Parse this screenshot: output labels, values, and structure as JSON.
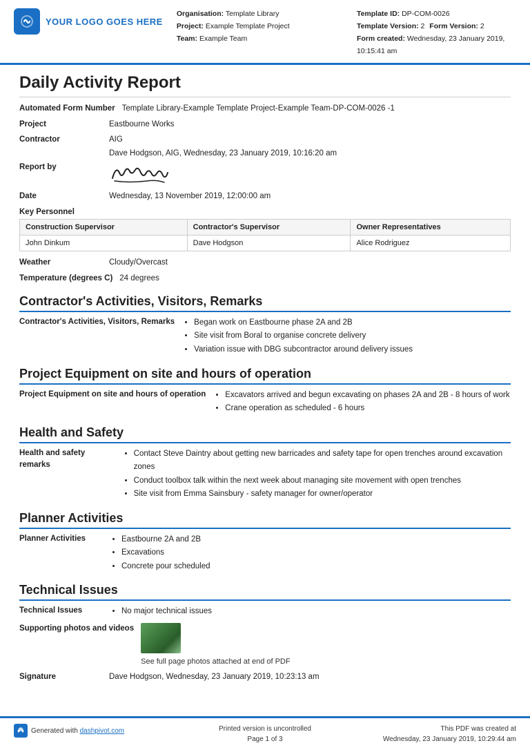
{
  "header": {
    "logo_text": "YOUR LOGO GOES HERE",
    "organisation_label": "Organisation:",
    "organisation_value": "Template Library",
    "project_label": "Project:",
    "project_value": "Example Template Project",
    "team_label": "Team:",
    "team_value": "Example Team",
    "template_id_label": "Template ID:",
    "template_id_value": "DP-COM-0026",
    "template_version_label": "Template Version:",
    "template_version_value": "2",
    "form_version_label": "Form Version:",
    "form_version_value": "2",
    "form_created_label": "Form created:",
    "form_created_value": "Wednesday, 23 January 2019, 10:15:41 am"
  },
  "report": {
    "title": "Daily Activity Report",
    "automated_form_number_label": "Automated Form Number",
    "automated_form_number_value": "Template Library-Example Template Project-Example Team-DP-COM-0026   -1",
    "project_label": "Project",
    "project_value": "Eastbourne Works",
    "contractor_label": "Contractor",
    "contractor_value": "AIG",
    "report_by_label": "Report by",
    "report_by_value": "Dave Hodgson, AIG, Wednesday, 23 January 2019, 10:16:20 am",
    "date_label": "Date",
    "date_value": "Wednesday, 13 November 2019, 12:00:00 am",
    "key_personnel_label": "Key Personnel",
    "personnel_headers": [
      "Construction Supervisor",
      "Contractor's Supervisor",
      "Owner Representatives"
    ],
    "personnel_row": [
      "John Dinkum",
      "Dave Hodgson",
      "Alice Rodriguez"
    ],
    "weather_label": "Weather",
    "weather_value": "Cloudy/Overcast",
    "temperature_label": "Temperature (degrees C)",
    "temperature_value": "24 degrees"
  },
  "contractors_activities": {
    "heading": "Contractor's Activities, Visitors, Remarks",
    "label": "Contractor's Activities, Visitors, Remarks",
    "items": [
      "Began work on Eastbourne phase 2A and 2B",
      "Site visit from Boral to organise concrete delivery",
      "Variation issue with DBG subcontractor around delivery issues"
    ]
  },
  "project_equipment": {
    "heading": "Project Equipment on site and hours of operation",
    "label": "Project Equipment on site and hours of operation",
    "items": [
      "Excavators arrived and begun excavating on phases 2A and 2B - 8 hours of work",
      "Crane operation as scheduled - 6 hours"
    ]
  },
  "health_safety": {
    "heading": "Health and Safety",
    "label": "Health and safety remarks",
    "items": [
      "Contact Steve Daintry about getting new barricades and safety tape for open trenches around excavation zones",
      "Conduct toolbox talk within the next week about managing site movement with open trenches",
      "Site visit from Emma Sainsbury - safety manager for owner/operator"
    ]
  },
  "planner_activities": {
    "heading": "Planner Activities",
    "label": "Planner Activities",
    "items": [
      "Eastbourne 2A and 2B",
      "Excavations",
      "Concrete pour scheduled"
    ]
  },
  "technical_issues": {
    "heading": "Technical Issues",
    "label": "Technical Issues",
    "items": [
      "No major technical issues"
    ],
    "supporting_label": "Supporting photos and videos",
    "photo_caption": "See full page photos attached at end of PDF",
    "signature_label": "Signature",
    "signature_value": "Dave Hodgson, Wednesday, 23 January 2019, 10:23:13 am"
  },
  "footer": {
    "generated_text": "Generated with",
    "link_text": "dashpivot.com",
    "link_url": "#",
    "uncontrolled_text": "Printed version is uncontrolled",
    "page_text": "Page 1 of 3",
    "pdf_created_text": "This PDF was created at",
    "pdf_created_value": "Wednesday, 23 January 2019, 10:29:44 am"
  }
}
